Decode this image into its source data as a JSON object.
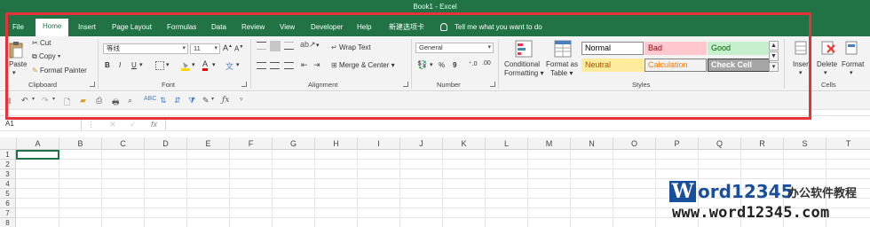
{
  "window": {
    "title": "Book1  -  Excel"
  },
  "tabs": [
    "File",
    "Home",
    "Insert",
    "Page Layout",
    "Formulas",
    "Data",
    "Review",
    "View",
    "Developer",
    "Help",
    "新建选项卡"
  ],
  "tell_me": "Tell me what you want to do",
  "clipboard": {
    "paste": "Paste",
    "cut": "Cut",
    "copy": "Copy",
    "format_painter": "Format Painter",
    "label": "Clipboard"
  },
  "font": {
    "name": "等线",
    "size": "11",
    "grow": "A",
    "shrink": "A",
    "bold": "B",
    "italic": "I",
    "underline": "U",
    "color_letter": "A",
    "label": "Font"
  },
  "alignment": {
    "wrap_text": "Wrap Text",
    "merge_center": "Merge & Center",
    "label": "Alignment"
  },
  "number": {
    "format": "General",
    "percent": "%",
    "comma": "9",
    "label": "Number"
  },
  "styles": {
    "conditional": [
      "Conditional",
      "Formatting"
    ],
    "format_table": [
      "Format as",
      "Table"
    ],
    "cells": [
      {
        "name": "Normal",
        "bg": "#ffffff",
        "fg": "#000000",
        "border": "#888888"
      },
      {
        "name": "Bad",
        "bg": "#ffc7ce",
        "fg": "#9c0006",
        "border": "#ffc7ce"
      },
      {
        "name": "Good",
        "bg": "#c6efce",
        "fg": "#006100",
        "border": "#c6efce"
      },
      {
        "name": "Neutral",
        "bg": "#ffeb9c",
        "fg": "#9c5700",
        "border": "#ffeb9c"
      },
      {
        "name": "Calculation",
        "bg": "#f2f2f2",
        "fg": "#fa7d00",
        "border": "#7f7f7f"
      },
      {
        "name": "Check Cell",
        "bg": "#a5a5a5",
        "fg": "#ffffff",
        "border": "#3f3f3f"
      }
    ],
    "label": "Styles"
  },
  "cells_group": {
    "insert": "Insert",
    "delete": "Delete",
    "format": "Format",
    "label": "Cells"
  },
  "formula_bar": {
    "name_box": "A1",
    "fx": "fx"
  },
  "columns": [
    "A",
    "B",
    "C",
    "D",
    "E",
    "F",
    "G",
    "H",
    "I",
    "J",
    "K",
    "L",
    "M",
    "N",
    "O",
    "P",
    "Q",
    "R",
    "S",
    "T"
  ],
  "rows": [
    "1",
    "2",
    "3",
    "4",
    "5",
    "6",
    "7",
    "8"
  ],
  "watermark": {
    "w": "W",
    "brand": "ord12345",
    "sub": "办公软件教程",
    "url": "www.word12345.com"
  },
  "colors": {
    "excel_green": "#217346",
    "highlight_red": "#e8323a"
  }
}
